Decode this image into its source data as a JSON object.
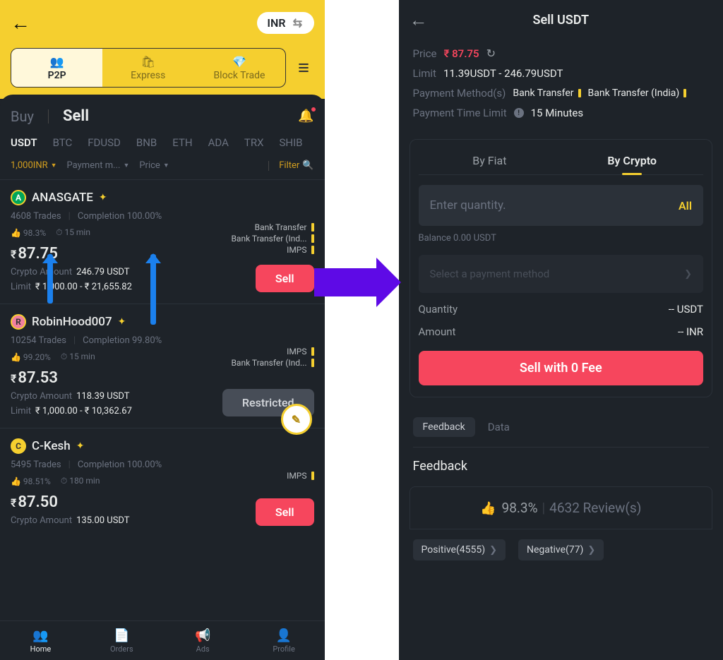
{
  "left": {
    "currency": "INR",
    "top_tabs": [
      "P2P",
      "Express",
      "Block Trade"
    ],
    "buy": "Buy",
    "sell": "Sell",
    "coins": [
      "USDT",
      "BTC",
      "FDUSD",
      "BNB",
      "ETH",
      "ADA",
      "TRX",
      "SHIB"
    ],
    "f_amount": "1,000INR",
    "f_payment": "Payment m...",
    "f_price": "Price",
    "f_filter": "Filter",
    "offers": [
      {
        "name": "ANASGATE",
        "avatar": "A",
        "acls": "a1",
        "trades": "4608 Trades",
        "completion": "Completion 100.00%",
        "thumb": "98.3%",
        "time": "15 min",
        "price": "87.75",
        "crypto": "246.79 USDT",
        "limit": "₹ 1,000.00 - ₹ 21,655.82",
        "methods": [
          "Bank Transfer",
          "Bank Transfer (Ind...",
          "IMPS"
        ],
        "btn": "Sell",
        "btncls": "sellbtn"
      },
      {
        "name": "RobinHood007",
        "avatar": "R",
        "acls": "a2",
        "trades": "10254 Trades",
        "completion": "Completion 99.80%",
        "thumb": "99.20%",
        "time": "15 min",
        "price": "87.53",
        "crypto": "118.39 USDT",
        "limit": "₹ 1,000.00 - ₹ 10,362.67",
        "methods": [
          "IMPS",
          "Bank Transfer (Ind..."
        ],
        "btn": "Restricted",
        "btncls": "sellbtn restricted"
      },
      {
        "name": "C-Kesh",
        "avatar": "C",
        "acls": "a3",
        "trades": "5495 Trades",
        "completion": "Completion 100.00%",
        "thumb": "98.51%",
        "time": "180 min",
        "price": "87.50",
        "crypto": "135.00 USDT",
        "limit": "",
        "methods": [
          "IMPS"
        ],
        "btn": "Sell",
        "btncls": "sellbtn"
      }
    ],
    "nav": [
      "Home",
      "Orders",
      "Ads",
      "Profile"
    ],
    "meta_crypto_label": "Crypto Amount",
    "meta_limit_label": "Limit"
  },
  "right": {
    "title": "Sell USDT",
    "price_k": "Price",
    "price_v": "₹ 87.75",
    "limit_k": "Limit",
    "limit_v": "11.39USDT - 246.79USDT",
    "pm_k": "Payment Method(s)",
    "pm_list": [
      "Bank Transfer",
      "Bank Transfer (India)"
    ],
    "ptl_k": "Payment Time Limit",
    "ptl_v": "15 Minutes",
    "tab_fiat": "By Fiat",
    "tab_crypto": "By Crypto",
    "qty_placeholder": "Enter quantity.",
    "all": "All",
    "balance": "Balance 0.00 USDT",
    "paysel": "Select a payment method",
    "q_k": "Quantity",
    "q_v": "-- USDT",
    "a_k": "Amount",
    "a_v": "-- INR",
    "bigbtn": "Sell with 0 Fee",
    "fb_tab": "Feedback",
    "data_tab": "Data",
    "fb_head": "Feedback",
    "fb_pct": "98.3%",
    "fb_reviews": "4632 Review(s)",
    "pos": "Positive(4555)",
    "neg": "Negative(77)"
  }
}
